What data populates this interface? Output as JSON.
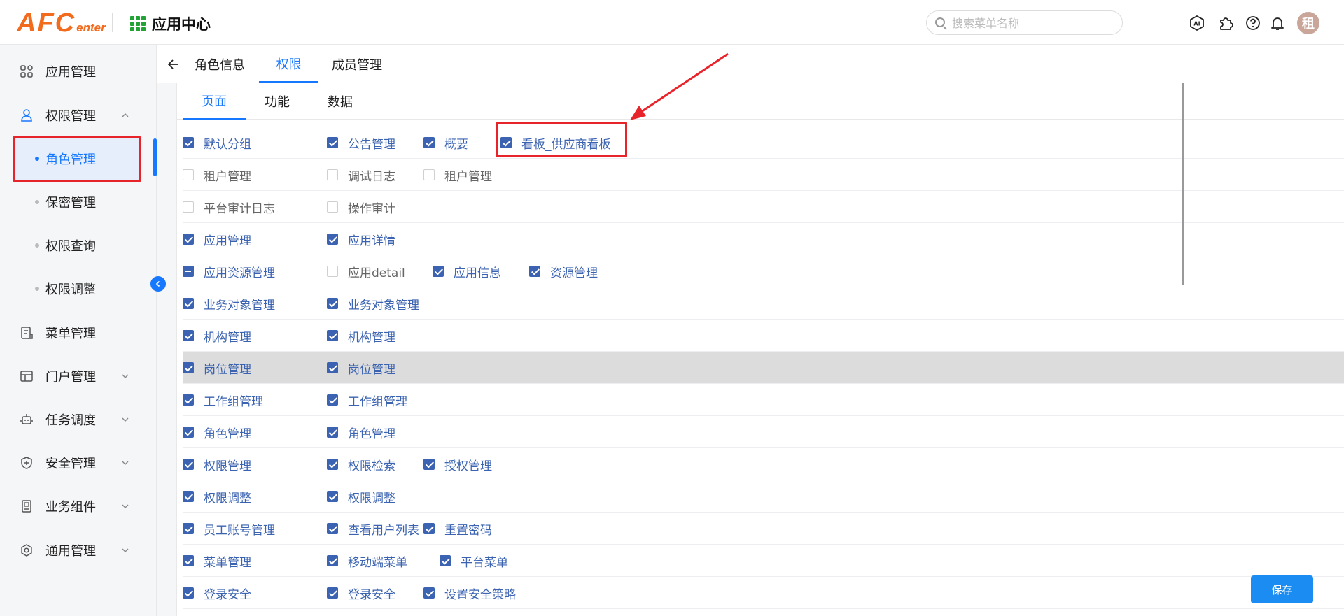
{
  "header": {
    "logo_main": "AFC",
    "logo_sub": "enter",
    "app_title": "应用中心",
    "search_placeholder": "搜索菜单名称",
    "avatar_text": "租",
    "icons": [
      "ai-icon",
      "puzzle-icon",
      "help-icon",
      "bell-icon"
    ]
  },
  "sidebar": {
    "items": [
      {
        "label": "应用管理",
        "icon": "grid-apps-icon"
      },
      {
        "label": "权限管理",
        "icon": "user-icon",
        "expanded": true
      },
      {
        "label": "菜单管理",
        "icon": "document-icon"
      },
      {
        "label": "门户管理",
        "icon": "portal-icon"
      },
      {
        "label": "任务调度",
        "icon": "robot-icon"
      },
      {
        "label": "安全管理",
        "icon": "shield-icon"
      },
      {
        "label": "业务组件",
        "icon": "component-icon"
      },
      {
        "label": "通用管理",
        "icon": "gear-icon"
      }
    ],
    "sub_items": [
      {
        "label": "角色管理",
        "active": true
      },
      {
        "label": "保密管理"
      },
      {
        "label": "权限查询"
      },
      {
        "label": "权限调整"
      }
    ]
  },
  "top_tabs": [
    {
      "label": "角色信息"
    },
    {
      "label": "权限",
      "active": true
    },
    {
      "label": "成员管理"
    }
  ],
  "sub_tabs": [
    {
      "label": "页面",
      "active": true
    },
    {
      "label": "功能"
    },
    {
      "label": "数据"
    }
  ],
  "permission_rows": [
    [
      {
        "label": "默认分组",
        "state": "checked"
      },
      {
        "label": "公告管理",
        "state": "checked"
      },
      {
        "label": "概要",
        "state": "checked"
      },
      {
        "label": "看板_供应商看板",
        "state": "checked"
      }
    ],
    [
      {
        "label": "租户管理",
        "state": "unchecked"
      },
      {
        "label": "调试日志",
        "state": "unchecked"
      },
      {
        "label": "租户管理",
        "state": "unchecked"
      }
    ],
    [
      {
        "label": "平台审计日志",
        "state": "unchecked"
      },
      {
        "label": "操作审计",
        "state": "unchecked"
      }
    ],
    [
      {
        "label": "应用管理",
        "state": "checked"
      },
      {
        "label": "应用详情",
        "state": "checked"
      }
    ],
    [
      {
        "label": "应用资源管理",
        "state": "indeterminate"
      },
      {
        "label": "应用detail",
        "state": "unchecked"
      },
      {
        "label": "应用信息",
        "state": "checked"
      },
      {
        "label": "资源管理",
        "state": "checked"
      }
    ],
    [
      {
        "label": "业务对象管理",
        "state": "checked"
      },
      {
        "label": "业务对象管理",
        "state": "checked"
      }
    ],
    [
      {
        "label": "机构管理",
        "state": "checked"
      },
      {
        "label": "机构管理",
        "state": "checked"
      }
    ],
    [
      {
        "label": "岗位管理",
        "state": "checked"
      },
      {
        "label": "岗位管理",
        "state": "checked"
      }
    ],
    [
      {
        "label": "工作组管理",
        "state": "checked"
      },
      {
        "label": "工作组管理",
        "state": "checked"
      }
    ],
    [
      {
        "label": "角色管理",
        "state": "checked"
      },
      {
        "label": "角色管理",
        "state": "checked"
      }
    ],
    [
      {
        "label": "权限管理",
        "state": "checked"
      },
      {
        "label": "权限检索",
        "state": "checked"
      },
      {
        "label": "授权管理",
        "state": "checked"
      }
    ],
    [
      {
        "label": "权限调整",
        "state": "checked"
      },
      {
        "label": "权限调整",
        "state": "checked"
      }
    ],
    [
      {
        "label": "员工账号管理",
        "state": "checked"
      },
      {
        "label": "查看用户列表",
        "state": "checked"
      },
      {
        "label": "重置密码",
        "state": "checked"
      }
    ],
    [
      {
        "label": "菜单管理",
        "state": "checked"
      },
      {
        "label": "移动端菜单",
        "state": "checked"
      },
      {
        "label": "平台菜单",
        "state": "checked"
      }
    ],
    [
      {
        "label": "登录安全",
        "state": "checked"
      },
      {
        "label": "登录安全",
        "state": "checked"
      },
      {
        "label": "设置安全策略",
        "state": "checked"
      }
    ]
  ],
  "save_label": "保存",
  "colors": {
    "accent": "#1677ff",
    "checkbox": "#3b63b1",
    "annotation_red": "#e8242b",
    "logo_orange": "#f26b1d"
  }
}
